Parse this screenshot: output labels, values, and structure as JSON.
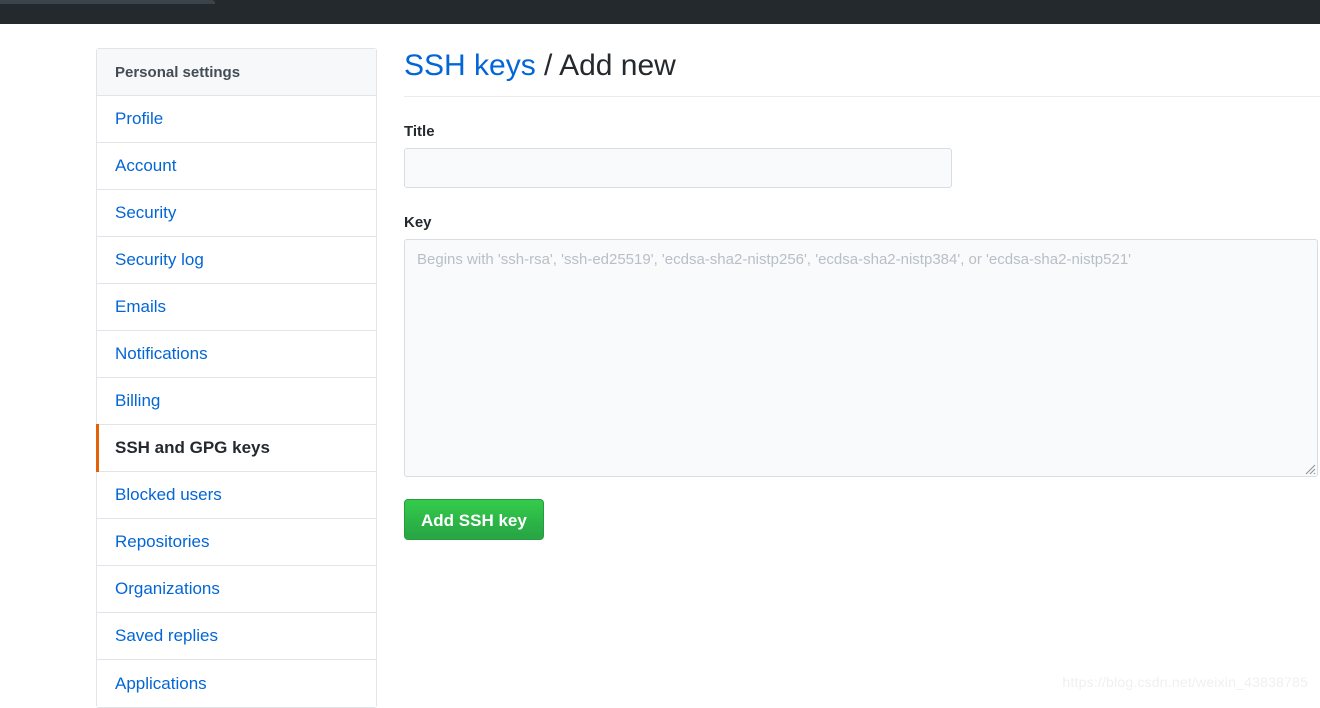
{
  "topbar": {
    "background_color": "#24292d",
    "strip_color": "#3c444b"
  },
  "sidebar": {
    "header_title": "Personal settings",
    "accent_color": "#e36209",
    "link_color": "#0366d6",
    "items": [
      {
        "label": "Profile",
        "selected": false
      },
      {
        "label": "Account",
        "selected": false
      },
      {
        "label": "Security",
        "selected": false
      },
      {
        "label": "Security log",
        "selected": false
      },
      {
        "label": "Emails",
        "selected": false
      },
      {
        "label": "Notifications",
        "selected": false
      },
      {
        "label": "Billing",
        "selected": false
      },
      {
        "label": "SSH and GPG keys",
        "selected": true
      },
      {
        "label": "Blocked users",
        "selected": false
      },
      {
        "label": "Repositories",
        "selected": false
      },
      {
        "label": "Organizations",
        "selected": false
      },
      {
        "label": "Saved replies",
        "selected": false
      },
      {
        "label": "Applications",
        "selected": false
      }
    ]
  },
  "main": {
    "heading": {
      "link_text": "SSH keys",
      "separator": " / ",
      "current": "Add new"
    },
    "form": {
      "title_label": "Title",
      "title_value": "",
      "title_placeholder": "",
      "key_label": "Key",
      "key_value": "",
      "key_placeholder": "Begins with 'ssh-rsa', 'ssh-ed25519', 'ecdsa-sha2-nistp256', 'ecdsa-sha2-nistp384', or 'ecdsa-sha2-nistp521'",
      "submit_label": "Add SSH key",
      "submit_color": "#28a745"
    }
  },
  "watermark": {
    "text": "https://blog.csdn.net/weixin_43838785"
  }
}
